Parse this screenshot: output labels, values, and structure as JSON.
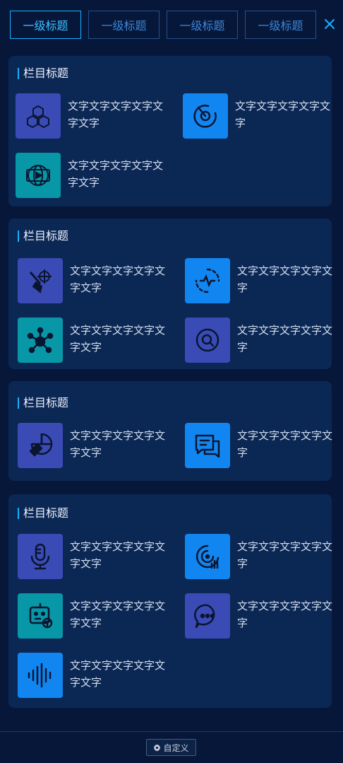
{
  "tabs": [
    {
      "label": "一级标题",
      "active": true
    },
    {
      "label": "一级标题",
      "active": false
    },
    {
      "label": "一级标题",
      "active": false
    },
    {
      "label": "一级标题",
      "active": false
    }
  ],
  "sections": [
    {
      "title": "栏目标题",
      "items": [
        {
          "label": "文字文字文字文字文字文字",
          "icon": "cubes-icon",
          "color": "#3a4bb5"
        },
        {
          "label": "文字文字文字文字文字",
          "icon": "radar-target-icon",
          "color": "#1286f0"
        },
        {
          "label": "文字文字文字文字文字文字",
          "icon": "globe-video-icon",
          "color": "#0797a6"
        }
      ]
    },
    {
      "title": "栏目标题",
      "items": [
        {
          "label": "文字文字文字文字文字文字",
          "icon": "scope-tool-icon",
          "color": "#3a4bb5"
        },
        {
          "label": "文字文字文字文字文字",
          "icon": "pulse-monitor-icon",
          "color": "#1286f0"
        },
        {
          "label": "文字文字文字文字文字文字",
          "icon": "network-node-icon",
          "color": "#0797a6"
        },
        {
          "label": "文字文字文字文字文字",
          "icon": "search-circle-icon",
          "color": "#3a4bb5"
        }
      ]
    },
    {
      "title": "栏目标题",
      "items": [
        {
          "label": "文字文字文字文字文字文字",
          "icon": "pie-hammer-icon",
          "color": "#3a4bb5"
        },
        {
          "label": "文字文字文字文字文字",
          "icon": "chat-bubbles-icon",
          "color": "#1286f0"
        }
      ]
    },
    {
      "title": "栏目标题",
      "items": [
        {
          "label": "文字文字文字文字文字文字",
          "icon": "microphone-icon",
          "color": "#3a4bb5"
        },
        {
          "label": "文字文字文字文字文字",
          "icon": "target-bars-icon",
          "color": "#1286f0"
        },
        {
          "label": "文字文字文字文字文字文字",
          "icon": "robot-icon",
          "color": "#0797a6"
        },
        {
          "label": "文字文字文字文字文字",
          "icon": "chat-dots-icon",
          "color": "#3a4bb5"
        },
        {
          "label": "文字文字文字文字文字文字",
          "icon": "sound-wave-icon",
          "color": "#1286f0"
        }
      ]
    }
  ],
  "footer": {
    "custom_label": "自定义",
    "custom_icon": "gear-icon"
  }
}
